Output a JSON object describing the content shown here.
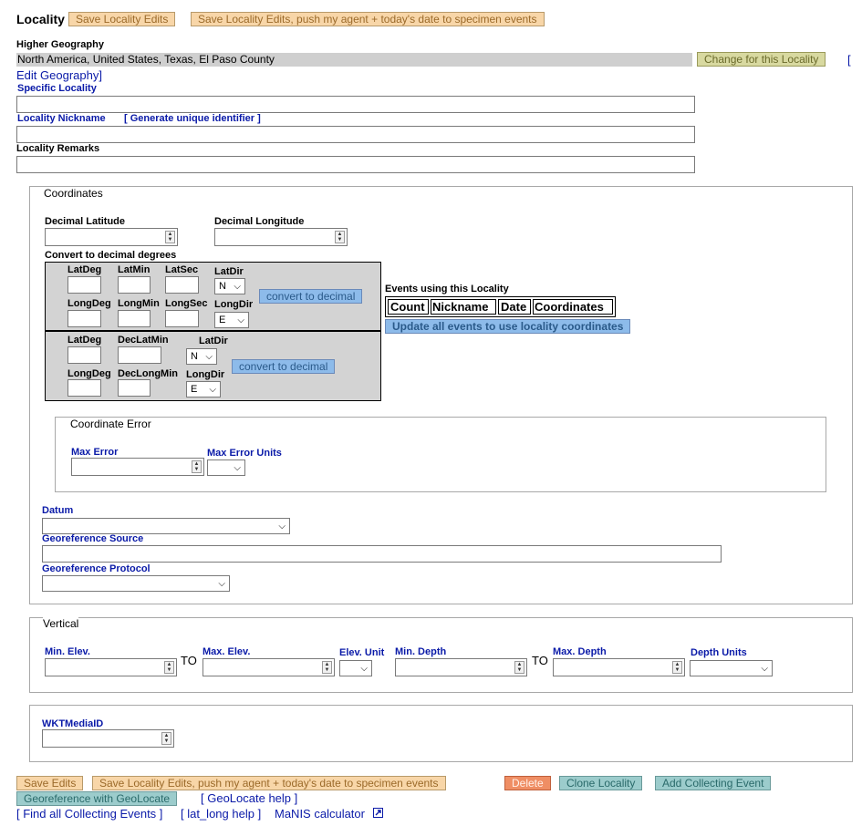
{
  "header": {
    "title": "Locality",
    "save_label": "Save Locality Edits",
    "save_push_label": "Save Locality Edits, push my agent + today's date to specimen events"
  },
  "higher_geography": {
    "label": "Higher Geography",
    "value": "North America, United States, Texas, El Paso County",
    "change_button": "Change for this Locality",
    "edit_link_open": "[",
    "edit_link": "Edit Geography]"
  },
  "specific_locality": {
    "label": "Specific Locality",
    "value": ""
  },
  "nickname": {
    "label": "Locality Nickname",
    "generate_link": "[ Generate unique identifier ]",
    "value": ""
  },
  "remarks": {
    "label": "Locality Remarks",
    "value": ""
  },
  "coordinates": {
    "legend": "Coordinates",
    "dec_lat_label": "Decimal Latitude",
    "dec_long_label": "Decimal Longitude",
    "convert_heading": "Convert to decimal degrees",
    "dms": {
      "lat_deg": "LatDeg",
      "lat_min": "LatMin",
      "lat_sec": "LatSec",
      "lat_dir": "LatDir",
      "lat_dir_value": "N",
      "long_deg": "LongDeg",
      "long_min": "LongMin",
      "long_sec": "LongSec",
      "long_dir": "LongDir",
      "long_dir_value": "E",
      "convert_button": "convert to decimal"
    },
    "ddm": {
      "lat_deg": "LatDeg",
      "dec_lat_min": "DecLatMin",
      "lat_dir": "LatDir",
      "lat_dir_value": "N",
      "long_deg": "LongDeg",
      "dec_long_min": "DecLongMin",
      "long_dir": "LongDir",
      "long_dir_value": "E",
      "convert_button": "convert to decimal"
    },
    "events": {
      "heading": "Events using this Locality",
      "columns": [
        "Count",
        "Nickname",
        "Date",
        "Coordinates"
      ],
      "update_button": "Update all events to use locality coordinates"
    },
    "error": {
      "legend": "Coordinate Error",
      "max_error_label": "Max Error",
      "max_error_units_label": "Max Error Units"
    },
    "datum_label": "Datum",
    "source_label": "Georeference Source",
    "protocol_label": "Georeference Protocol"
  },
  "vertical": {
    "legend": "Vertical",
    "min_elev": "Min. Elev.",
    "to1": "TO",
    "max_elev": "Max. Elev.",
    "elev_unit": "Elev. Unit",
    "min_depth": "Min. Depth",
    "to2": "TO",
    "max_depth": "Max. Depth",
    "depth_units": "Depth Units"
  },
  "wkt": {
    "label": "WKTMediaID"
  },
  "footer": {
    "save_edits": "Save Edits",
    "save_push": "Save Locality Edits, push my agent + today's date to specimen events",
    "delete": "Delete",
    "clone": "Clone Locality",
    "add_event": "Add Collecting Event",
    "geolocate": "Georeference with GeoLocate",
    "geolocate_help": "[ GeoLocate help ]",
    "find_all": "[ Find all Collecting Events ]",
    "latlong_help": "[ lat_long help ]",
    "manis": "MaNIS calculator"
  }
}
